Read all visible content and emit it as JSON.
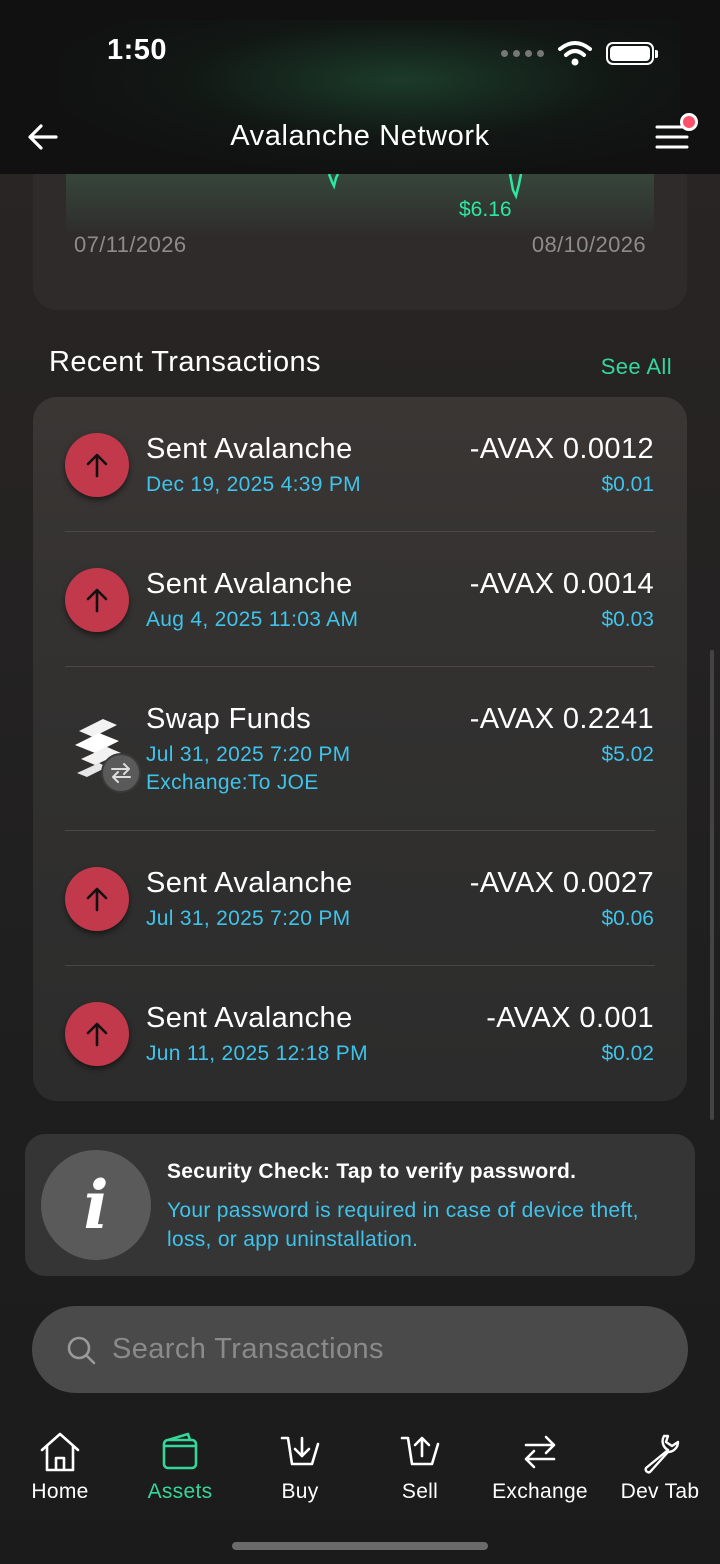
{
  "status_bar": {
    "time": "1:50"
  },
  "header": {
    "title": "Avalanche Network"
  },
  "chart": {
    "low_label": "$6.16",
    "start_date": "07/11/2026",
    "end_date": "08/10/2026"
  },
  "transactions_section": {
    "title": "Recent Transactions",
    "see_all": "See All"
  },
  "transactions": [
    {
      "type": "sent",
      "title": "Sent Avalanche",
      "date": "Dec 19, 2025  4:39 PM",
      "amount": "-AVAX 0.0012",
      "fiat": "$0.01"
    },
    {
      "type": "sent",
      "title": "Sent Avalanche",
      "date": "Aug 4, 2025  11:03 AM",
      "amount": "-AVAX 0.0014",
      "fiat": "$0.03"
    },
    {
      "type": "swap",
      "title": "Swap Funds",
      "date": "Jul 31, 2025  7:20 PM",
      "extra": "Exchange:To JOE",
      "amount": "-AVAX 0.2241",
      "fiat": "$5.02"
    },
    {
      "type": "sent",
      "title": "Sent Avalanche",
      "date": "Jul 31, 2025  7:20 PM",
      "amount": "-AVAX 0.0027",
      "fiat": "$0.06"
    },
    {
      "type": "sent",
      "title": "Sent Avalanche",
      "date": "Jun 11, 2025  12:18 PM",
      "amount": "-AVAX 0.001",
      "fiat": "$0.02"
    }
  ],
  "security": {
    "icon": "i",
    "title": "Security Check: Tap to verify password.",
    "body": "Your password is required in case of device theft, loss, or app uninstallation."
  },
  "search": {
    "placeholder": "Search Transactions",
    "value": ""
  },
  "tabs": [
    {
      "label": "Home",
      "icon": "home-icon",
      "active": false
    },
    {
      "label": "Assets",
      "icon": "wallet-icon",
      "active": true
    },
    {
      "label": "Buy",
      "icon": "buy-icon",
      "active": false
    },
    {
      "label": "Sell",
      "icon": "sell-icon",
      "active": false
    },
    {
      "label": "Exchange",
      "icon": "exchange-icon",
      "active": false
    },
    {
      "label": "Dev Tab",
      "icon": "wrench-icon",
      "active": false
    }
  ],
  "colors": {
    "accent": "#35d69a",
    "link_blue": "#3fc3ea",
    "sent_red": "#c2394c"
  }
}
